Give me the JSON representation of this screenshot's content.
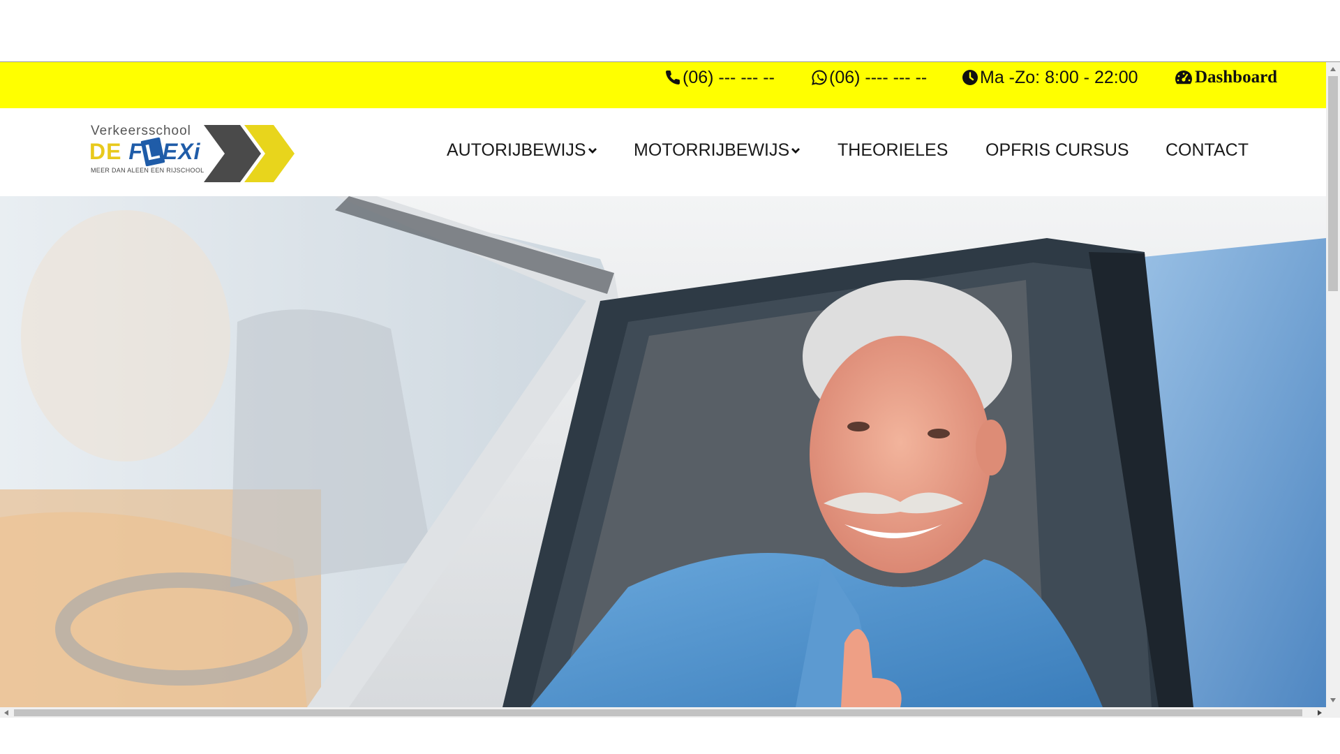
{
  "topbar": {
    "phone": "(06) --- --- --",
    "whatsapp": "(06) ---- --- --",
    "hours": "Ma -Zo: 8:00 - 22:00",
    "dashboard": "Dashboard",
    "background": "#ffff00"
  },
  "logo": {
    "top_text": "Verkeersschool",
    "main_de": "DE",
    "main_f": "F",
    "main_l": "L",
    "main_exi": "EXi",
    "tagline": "MEER DAN ALEEN EEN RIJSCHOOL",
    "colors": {
      "yellow": "#e8c91c",
      "blue": "#1f5ca8",
      "dark": "#4a4a4a"
    }
  },
  "nav": {
    "items": [
      {
        "label": "AUTORIJBEWIJS",
        "has_dropdown": true
      },
      {
        "label": "MOTORRIJBEWIJS",
        "has_dropdown": true
      },
      {
        "label": "THEORIELES",
        "has_dropdown": false
      },
      {
        "label": "OPFRIS CURSUS",
        "has_dropdown": false
      },
      {
        "label": "CONTACT",
        "has_dropdown": false
      }
    ]
  },
  "hero": {
    "image": "smiling senior man in blue shirt in car window giving thumbs up, woman passenger in background"
  }
}
